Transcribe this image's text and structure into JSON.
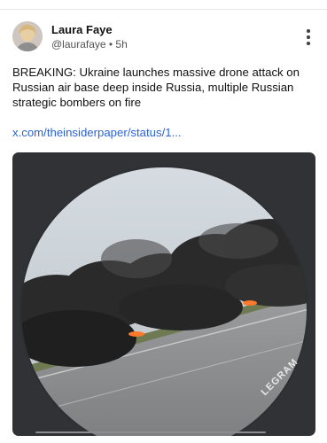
{
  "post": {
    "author_name": "Laura Faye",
    "handle_and_time": "@laurafaye • 5h",
    "text": "BREAKING: Ukraine launches massive drone attack on Russian air base deep inside Russia, multiple Russian strategic bombers on fire",
    "link_text": "x.com/theinsiderpaper/status/1...",
    "media_watermark": "LEGRAM"
  },
  "icons": {
    "menu": "more-vertical-icon",
    "avatar": "profile-photo"
  }
}
